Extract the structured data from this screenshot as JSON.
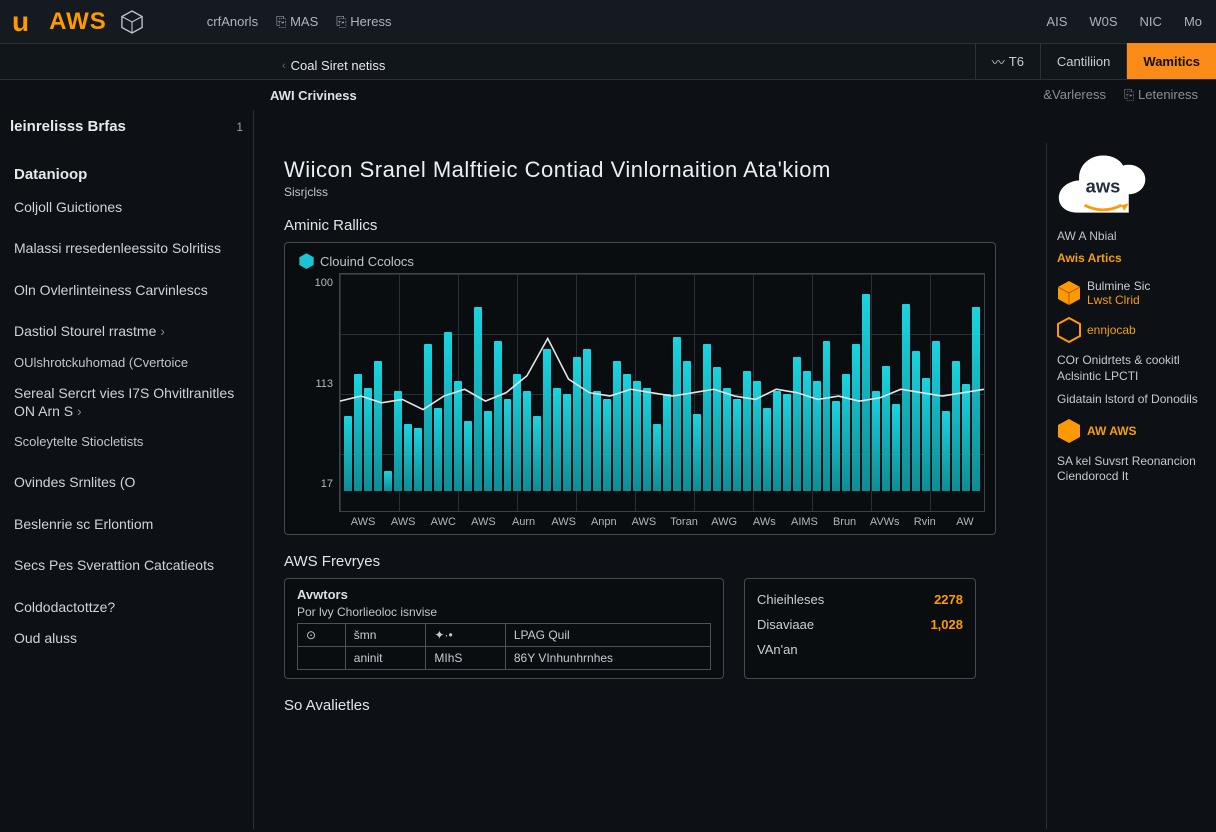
{
  "header": {
    "brand_u": "u",
    "brand_text": "AWS",
    "top_nav": [
      "crfAnorls",
      "MAS",
      "Heress"
    ],
    "top_nav_right": [
      "AIS",
      "W0S",
      "NIC",
      "Mo"
    ]
  },
  "tabs": {
    "items": [
      {
        "label": "Coal Siret netiss",
        "back": true
      },
      {
        "icon": "trend-icon",
        "label": "T6"
      },
      {
        "label": "Cantiliion"
      },
      {
        "label": "Wamitics",
        "highlight": true
      }
    ]
  },
  "utilrow": {
    "left": "AWI Criviness",
    "right": [
      "&Varleress",
      "⎘ Leteniress"
    ]
  },
  "sidebar": {
    "header": "leinrelisss Brfas",
    "header_badge": "1",
    "items": [
      {
        "label": "Datanioop",
        "title": true
      },
      {
        "label": "Coljoll Guictiones"
      },
      {
        "label": "Malassi rresedenleessito Solritiss"
      },
      {
        "label": "Oln Ovlerlinteiness Carvinlescs"
      },
      {
        "label": "Dastiol Stourel rrastme",
        "exp": true
      },
      {
        "label": "OUlshrotckuhomad (Cvertoice",
        "sub": true
      },
      {
        "label": "Sereal Sercrt vies I7S Ohvitlranitles ON Arn S",
        "exp": true
      },
      {
        "label": "Scoleytelte Stiocletists",
        "sub": true
      },
      {
        "label": "Ovindes Srnlites (O"
      },
      {
        "label": "Beslenrie sc Erlontiom"
      },
      {
        "label": "Secs Pes Sverattion Catcatieots"
      },
      {
        "label": "Coldodactottze?"
      },
      {
        "label": "Oud aluss"
      }
    ]
  },
  "page": {
    "title": "Wiicon Sranel Malftieic Contiad Vinlornaition Ata'kiom",
    "subtitle": "Sisrjclss"
  },
  "chart": {
    "section_title": "Aminic Rallics",
    "panel_label": "Clouind Ccolocs"
  },
  "chart_data": {
    "type": "bar+line",
    "ylabels": [
      "100",
      "113",
      "17"
    ],
    "ylim": [
      0,
      130
    ],
    "categories": [
      "AWS",
      "AWS",
      "AWC",
      "AWS",
      "Aurn",
      "AWS",
      "Anpn",
      "AWS",
      "Toran",
      "AWG",
      "AWs",
      "AIMS",
      "Brun",
      "AVWs",
      "Rvin",
      "AW"
    ],
    "series": [
      {
        "name": "bars",
        "type": "bar",
        "values": [
          45,
          70,
          62,
          78,
          12,
          60,
          40,
          38,
          88,
          50,
          95,
          66,
          42,
          110,
          48,
          90,
          55,
          70,
          60,
          45,
          85,
          62,
          58,
          80,
          85,
          60,
          55,
          78,
          70,
          66,
          62,
          40,
          58,
          92,
          78,
          46,
          88,
          74,
          62,
          55,
          72,
          66,
          50,
          60,
          58,
          80,
          72,
          66,
          90,
          54,
          70,
          88,
          118,
          60,
          75,
          52,
          112,
          84,
          68,
          90,
          48,
          78,
          64,
          110
        ]
      },
      {
        "name": "line",
        "type": "line",
        "values": [
          55,
          58,
          54,
          56,
          50,
          58,
          62,
          55,
          60,
          70,
          92,
          68,
          60,
          58,
          62,
          60,
          58,
          60,
          62,
          58,
          56,
          62,
          60,
          56,
          58,
          55,
          57,
          62,
          60,
          58,
          60,
          62
        ]
      }
    ]
  },
  "tables": {
    "section_title": "AWS Frevryes",
    "card1": {
      "head": "Avwtors",
      "sub": "Por lvy Chorlieoloc isnvise",
      "rows": [
        [
          "⊙",
          "šmn",
          "✦·•",
          "LPAG Quil"
        ],
        [
          "",
          "aninit",
          "MIhS",
          "86Y VInhunhrnhes"
        ]
      ]
    },
    "card2": {
      "rows": [
        {
          "k": "Chieihleses",
          "v": "2278"
        },
        {
          "k": "Disaviaae",
          "v": "1,028"
        },
        {
          "k": "VAn'an",
          "v": ""
        }
      ]
    },
    "next_section": "So Avalietles"
  },
  "rail": {
    "links_top": [],
    "section1_a": "AW A Nbial",
    "section1_b": "Awis Artics",
    "cube1_a": "Bulmine Sic",
    "cube1_b": "Lwst Clrid",
    "cube2": "ennjocab",
    "para1": "COr Onidrtets & cookitl Aclsintic LPCTI",
    "para2": "Gidatain lstord of Donodils",
    "cube3": "AW AWS",
    "para3": "SA kel Suvsrt Reonancion Ciendorocd It"
  }
}
